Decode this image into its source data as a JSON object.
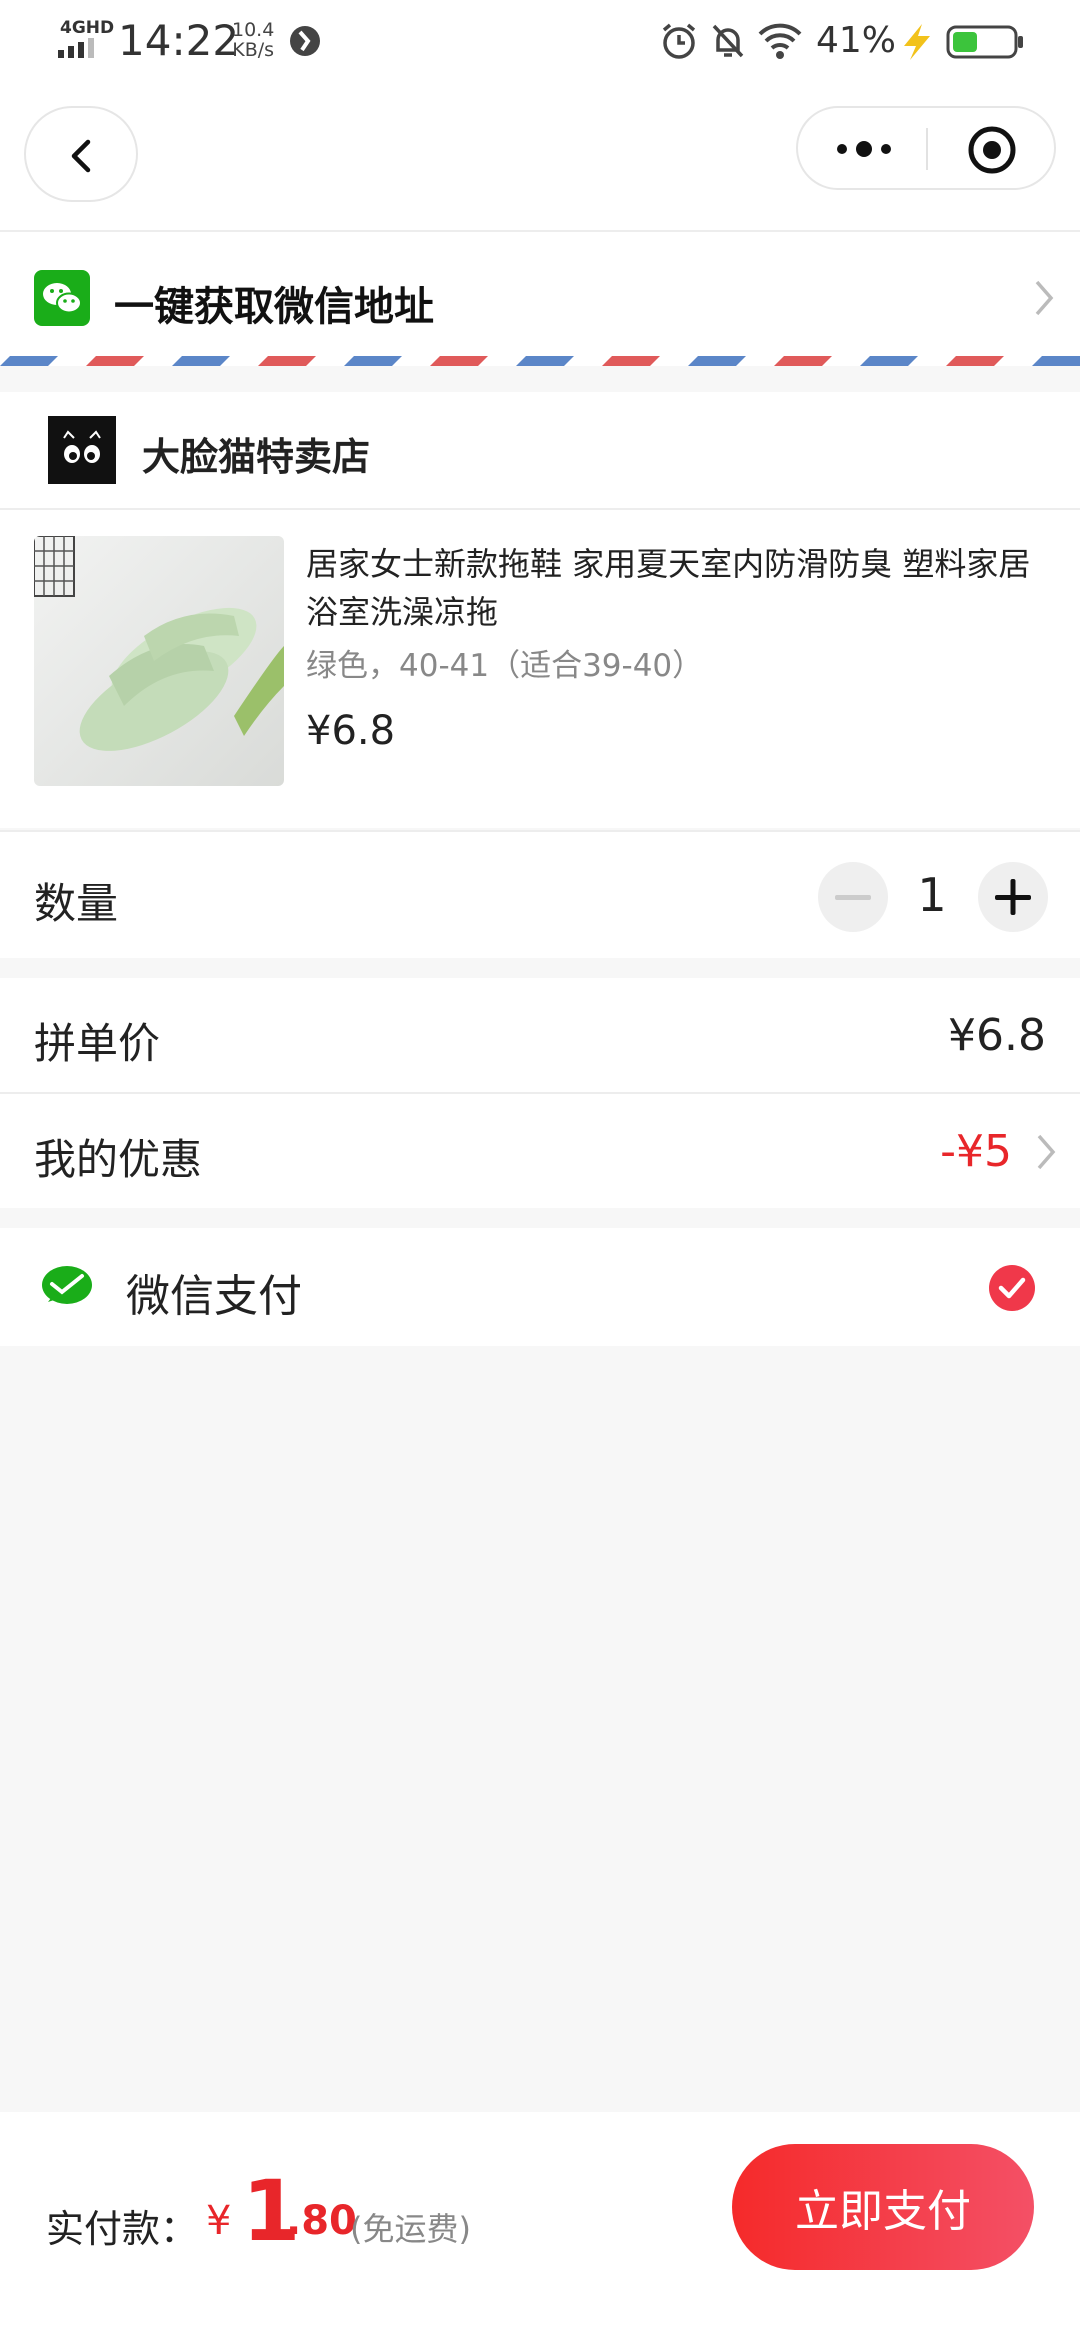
{
  "status_bar": {
    "network": "4GHD",
    "time": "14:22",
    "speed_value": "10.4",
    "speed_unit": "KB/s",
    "battery_percent": "41%"
  },
  "nav": {
    "back_icon": "chevron-left-icon",
    "more_icon": "more-dots-icon",
    "close_icon": "target-icon"
  },
  "address": {
    "label": "一键获取微信地址",
    "icon": "wechat-icon"
  },
  "store": {
    "name": "大脸猫特卖店"
  },
  "product": {
    "title": "居家女士新款拖鞋 家用夏天室内防滑防臭 塑料家居浴室洗澡凉拖",
    "spec": "绿色，40-41（适合39-40）",
    "price": "¥6.8"
  },
  "quantity": {
    "label": "数量",
    "value": "1"
  },
  "pricing": {
    "group_price_label": "拼单价",
    "group_price_value": "¥6.8",
    "discount_label": "我的优惠",
    "discount_value": "-¥5"
  },
  "payment": {
    "method": "微信支付",
    "selected": true
  },
  "footer": {
    "total_label": "实付款：",
    "currency": "¥",
    "amount_int": "1",
    "amount_dec": ".80",
    "shipping_note": "(免运费)",
    "pay_button": "立即支付"
  },
  "colors": {
    "accent_red": "#e8262a",
    "wechat_green": "#1aad19",
    "stripe_blue": "#5b86c8",
    "stripe_red": "#e05a5a"
  }
}
